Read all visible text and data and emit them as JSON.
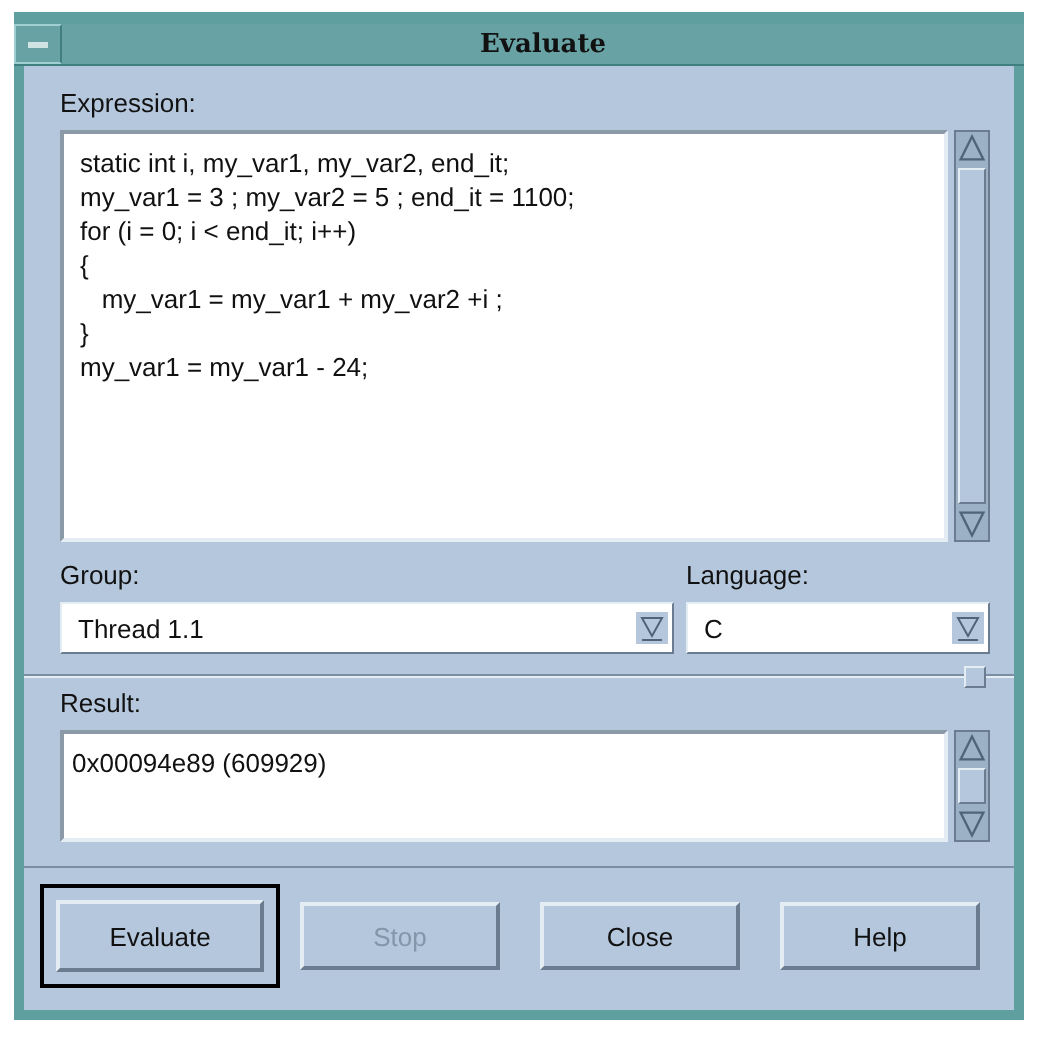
{
  "window": {
    "title": "Evaluate"
  },
  "expression": {
    "label": "Expression:",
    "lines": [
      "static int i, my_var1, my_var2, end_it;",
      "my_var1 = 3 ; my_var2 = 5 ; end_it = 1100;",
      "for (i = 0; i < end_it; i++)",
      "{",
      "   my_var1 = my_var1 + my_var2 +i ;",
      "}",
      "my_var1 = my_var1 - 24;"
    ]
  },
  "group": {
    "label": "Group:",
    "value": "Thread 1.1"
  },
  "language": {
    "label": "Language:",
    "value": "C"
  },
  "result": {
    "label": "Result:",
    "value": "0x00094e89 (609929)"
  },
  "buttons": [
    {
      "label": "Evaluate",
      "default": true,
      "disabled": false
    },
    {
      "label": "Stop",
      "default": false,
      "disabled": true
    },
    {
      "label": "Close",
      "default": false,
      "disabled": false
    },
    {
      "label": "Help",
      "default": false,
      "disabled": false
    }
  ]
}
